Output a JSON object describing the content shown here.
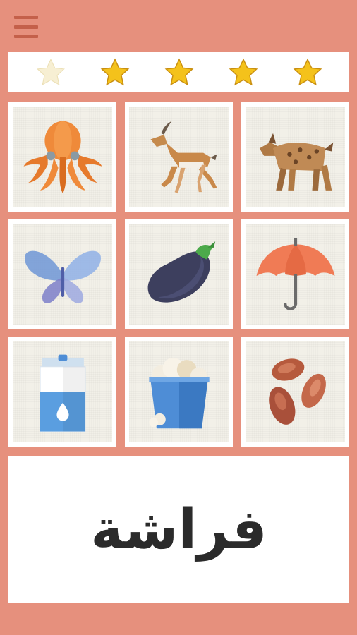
{
  "header": {
    "menu_icon": "hamburger-menu-icon"
  },
  "stars": {
    "total": 5,
    "items": [
      {
        "state": "empty",
        "icon": "star-icon"
      },
      {
        "state": "filled",
        "icon": "star-icon"
      },
      {
        "state": "filled",
        "icon": "star-icon"
      },
      {
        "state": "filled",
        "icon": "star-icon"
      },
      {
        "state": "filled",
        "icon": "star-icon"
      }
    ],
    "filled_color": "#f4c21b",
    "empty_color": "#f7efd3"
  },
  "tiles": [
    {
      "icon": "octopus-icon"
    },
    {
      "icon": "gazelle-icon"
    },
    {
      "icon": "hyena-icon"
    },
    {
      "icon": "butterfly-icon"
    },
    {
      "icon": "eggplant-icon"
    },
    {
      "icon": "umbrella-icon"
    },
    {
      "icon": "milk-carton-icon"
    },
    {
      "icon": "popcorn-bucket-icon"
    },
    {
      "icon": "beans-icon"
    }
  ],
  "word_panel": {
    "word": "فراشة"
  },
  "colors": {
    "background": "#e6907d",
    "panel": "#ffffff",
    "text": "#2b2b2b"
  }
}
